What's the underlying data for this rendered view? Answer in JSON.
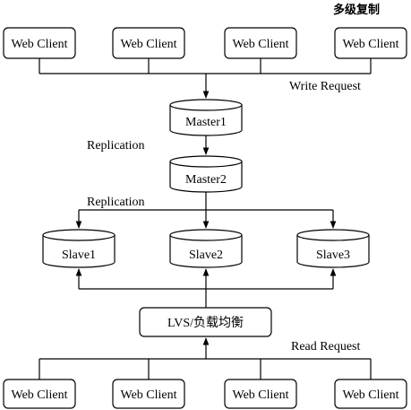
{
  "title": "多级复制",
  "top_clients": [
    "Web Client",
    "Web Client",
    "Web Client",
    "Web Client"
  ],
  "write_request": "Write Request",
  "master1": "Master1",
  "replication_1": "Replication",
  "master2": "Master2",
  "replication_2": "Replication",
  "slaves": [
    "Slave1",
    "Slave2",
    "Slave3"
  ],
  "load_balancer": "LVS/负载均衡",
  "read_request": "Read Request",
  "bottom_clients": [
    "Web Client",
    "Web Client",
    "Web Client",
    "Web Client"
  ],
  "colors": {
    "stroke": "#000000",
    "background": "#ffffff"
  }
}
